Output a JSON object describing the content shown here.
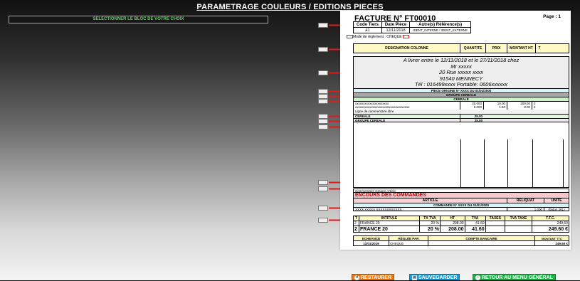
{
  "page_title": "PARAMETRAGE COULEURS / EDITIONS PIECES",
  "select_label": "SELECTIONNER LE BLOC DE VOTRE CHOIX",
  "invoice": {
    "title": "FACTURE N° FT00010",
    "page": "Page : 1",
    "headers": {
      "code": "Code Tiers",
      "date": "Date Pièce",
      "refs": "Autre(s) Référence(s)"
    },
    "values": {
      "code": "41",
      "date": "12/11/2018",
      "refs": "IDENT_INTERNE / IDENT_EXTERNE"
    },
    "mode_label": "Mode de règlement :",
    "mode_value": "CHEQUE",
    "columns": {
      "designation": "DESIGNATION COLONNE",
      "qty": "QUANTITE",
      "price": "PRIX",
      "amount": "MONTANT HT",
      "t": "T"
    },
    "address": [
      "A livrer entre le 12/11/2018 et le 27/11/2018 chez",
      "Mr xxxxx",
      "20 Rue xxxxx xxxx",
      "91540 MENNECY",
      "Tél : 016499xxxx Portable: 0606xxxxxx"
    ],
    "piece_origine": "PIECE ORIGINE N° XXXX DU 01/01/2000",
    "groupe_cereale": "GROUPE CEREALE",
    "cereale": "CEREALE",
    "lines": [
      {
        "d": "xxxxxxxxxxxxxxxxxxxxx",
        "q": "20.000",
        "p": "10.00",
        "m": "200.00",
        "t": "2"
      },
      {
        "d": "xxxxxxxxxxxxxxxxxxxxxxxxxxxxxxxxxx",
        "q": "5.000",
        "p": "1.60",
        "m": "8.00",
        "t": "2"
      }
    ],
    "comment_line": "Ligne de commentaire libre",
    "subtotal_cereale": {
      "label": "CEREALE",
      "value": "25.00"
    },
    "subtotal_groupe": {
      "label": "GROUPE CEREALE",
      "value": "25.00"
    },
    "comment_groupe": "Commentaire Groupe Article",
    "encours": "ENCOURS DES COMMANDES",
    "enc_cols": {
      "article": "ARTICLE",
      "reliquat": "RELIQUAT",
      "unite": "UNITE"
    },
    "commande": "COMMANDE N° XXXX DU 01/01/2000",
    "enc_line": {
      "d": "XXXX XXXXX XXXXXXXXXXXX",
      "q": "1.000",
      "u": "(Bidon 20L)"
    },
    "tva_headers": {
      "t": "T",
      "intitule": "INTITULE",
      "tx": "TX TVA",
      "ht": "HT",
      "tva": "TVA",
      "taxes": "TAXES",
      "tvataxe": "TVA TAXE",
      "ttc": "T.T.C."
    },
    "tva_row1": {
      "t": "2",
      "intitule": "FRANCE 20",
      "tx": "20 %",
      "ht": "208.00",
      "tva": "41.60",
      "ttc": "249.60"
    },
    "tva_row2": {
      "t": "2",
      "intitule": "FRANCE 20",
      "tx": "20 %",
      "ht": "208.00",
      "tva": "41.60",
      "ttc": "249.60 €"
    },
    "ech_headers": {
      "ech": "ECHEANCE",
      "reglee": "RÉGLÉE PAR",
      "compte": "COMPTE BANCAIRE",
      "ttc": "MONTANT TTC"
    },
    "ech_row": {
      "ech": "11/01/2019",
      "reglee": "CHEQUE",
      "ttc": "249.60 €"
    }
  },
  "buttons": {
    "restore": "RESTAURER",
    "save": "SAUVEGARDER",
    "menu": "RETOUR AU MENU GÉNÉRAL"
  },
  "colors": {
    "restore": "#f07a1a",
    "save": "#1e9ad6",
    "menu": "#22b24a",
    "arrow": "#e01b1b"
  }
}
